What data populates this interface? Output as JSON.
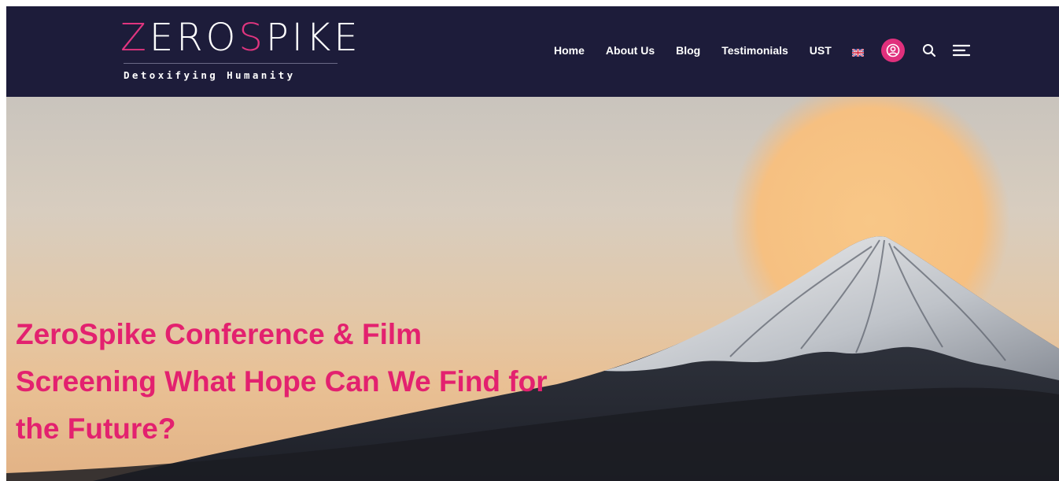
{
  "brand": {
    "logo_prefix": "ZER",
    "logo_accent_left": "Z",
    "logo_mid": "ER",
    "logo_o": "O",
    "logo_accent_s": "S",
    "logo_suffix": "PIKE",
    "tagline": "Detoxifying Humanity"
  },
  "nav": {
    "items": [
      "Home",
      "About Us",
      "Blog",
      "Testimonials",
      "UST"
    ]
  },
  "icons": {
    "flag": "uk-flag-icon",
    "account": "user-circle-icon",
    "search": "search-icon",
    "menu": "hamburger-menu-icon"
  },
  "colors": {
    "header_bg": "#1d1c3a",
    "accent": "#e0307c",
    "title": "#e3216f",
    "sun": "#f6c387"
  },
  "hero": {
    "title": "ZeroSpike Conference & Film Screening What Hope Can We Find for the Future?"
  }
}
